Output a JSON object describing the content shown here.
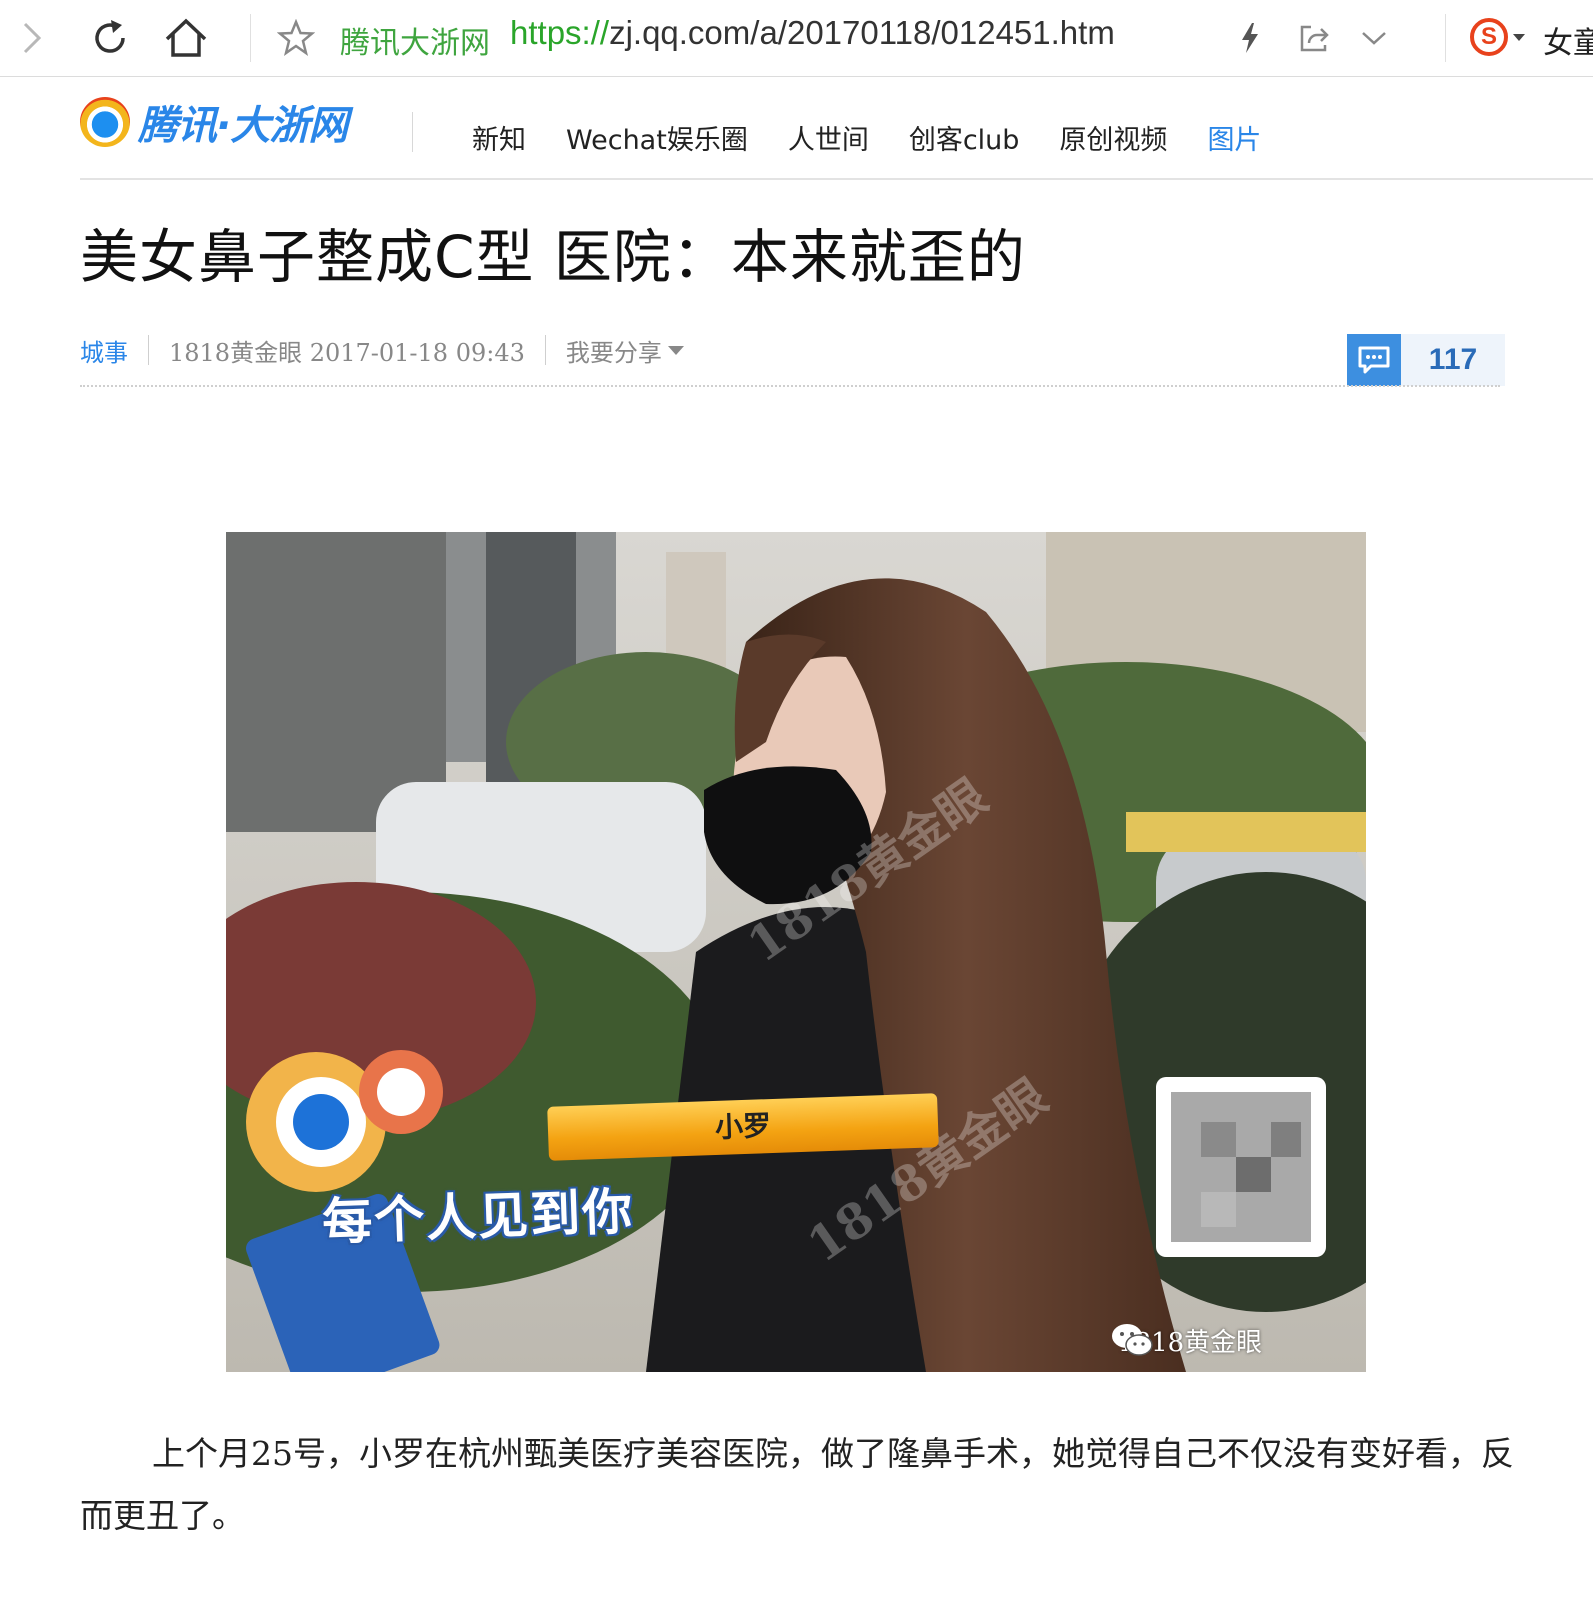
{
  "browser": {
    "site_name": "腾讯大浙网",
    "url_protocol": "https://",
    "url_rest": "zj.qq.com/a/20170118/012451.htm",
    "right_text": "女童",
    "search_engine_glyph": "S",
    "icons": [
      "forward-icon",
      "reload-icon",
      "home-icon",
      "star-icon",
      "lightning-icon",
      "share-icon",
      "chevron-down-icon",
      "sogou-icon"
    ]
  },
  "site": {
    "logo_text": "腾讯·大浙网",
    "nav": [
      "新知",
      "Wechat娱乐圈",
      "人世间",
      "创客club",
      "原创视频",
      "图片"
    ],
    "active_nav_index": 5,
    "accent_color": "#2a86e8"
  },
  "article": {
    "title": "美女鼻子整成C型 医院：本来就歪的",
    "category": "城事",
    "source_time": "1818黄金眼 2017-01-18 09:43",
    "share_label": "我要分享",
    "comment_count": "117",
    "image": {
      "name_tag": "小罗",
      "caption": "每个人见到你",
      "watermark": "1818黄金眼",
      "diagonal_mark": "1818黄金眼"
    },
    "paragraph": "上个月25号，小罗在杭州甄美医疗美容医院，做了隆鼻手术，她觉得自己不仅没有变好看，反而更丑了。"
  }
}
